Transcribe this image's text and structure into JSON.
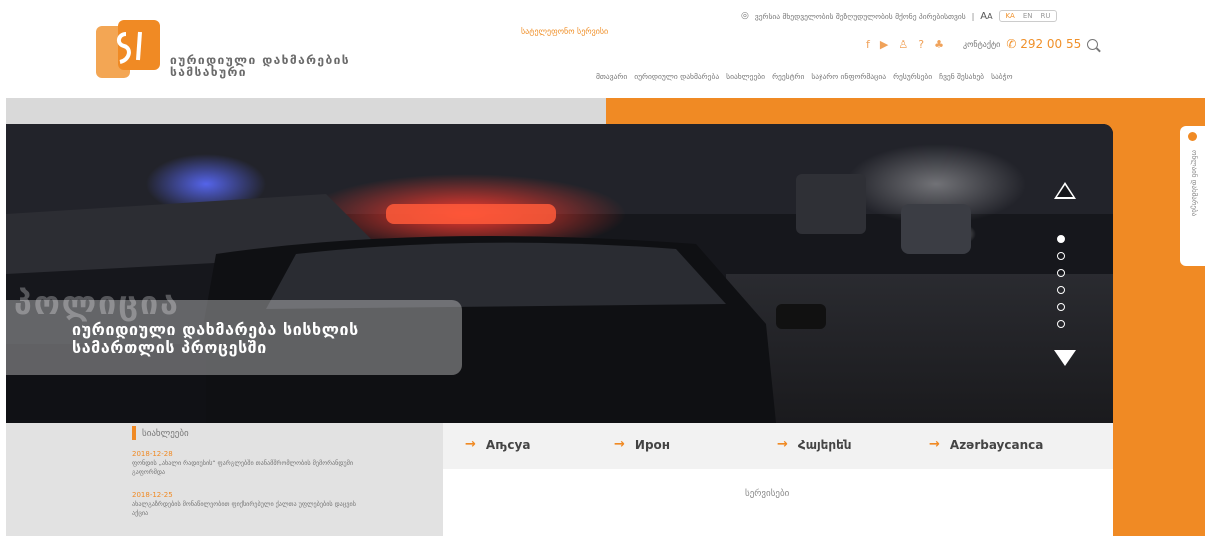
{
  "header": {
    "logo_line1": "იურიდიული დახმარების",
    "logo_line2": "სამსახური",
    "hotline": "სატელეფონო სერვისი",
    "accessibility_text": "ვერსია მხედველობის შეზღუდულობის მქონე პირებისთვის",
    "font_size_label": "A",
    "font_size_small": "A",
    "languages": [
      "KA",
      "EN",
      "RU"
    ],
    "contact_label": "კონტაქტი",
    "phone": "292 00 55",
    "nav": [
      "მთავარი",
      "იურიდიული დახმარება",
      "სიახლეები",
      "რეესტრი",
      "საჯარო ინფორმაცია",
      "რესურსები",
      "ჩვენ შესახებ",
      "საბჭო"
    ]
  },
  "hero": {
    "badge": "პოლიცია",
    "title": "იურიდიული დახმარება სისხლის სამართლის პროცესში",
    "slides": 6,
    "active_slide": 0
  },
  "side_tab": {
    "label": "ონლაინ დახმარება"
  },
  "news": {
    "title": "სიახლეები",
    "items": [
      {
        "date": "2018-12-28",
        "text": "ფონდის „ახალი რადიუსის“ ფარგლებში თანამშრომლობის მემორანდუმი გაფორმდა"
      },
      {
        "date": "2018-12-25",
        "text": "ახალგაზრდების მონაწილეობით ფიქსირებული ქალთა უფლებების დაცვის აქცია"
      }
    ]
  },
  "languages_bar": [
    {
      "label": "Аҧсуа"
    },
    {
      "label": "Ирон"
    },
    {
      "label": "Հայերեն"
    },
    {
      "label": "Azərbaycanca"
    }
  ],
  "services_label": "სერვისები",
  "colors": {
    "accent": "#f08a24",
    "band_gray": "#d9d9d9"
  }
}
